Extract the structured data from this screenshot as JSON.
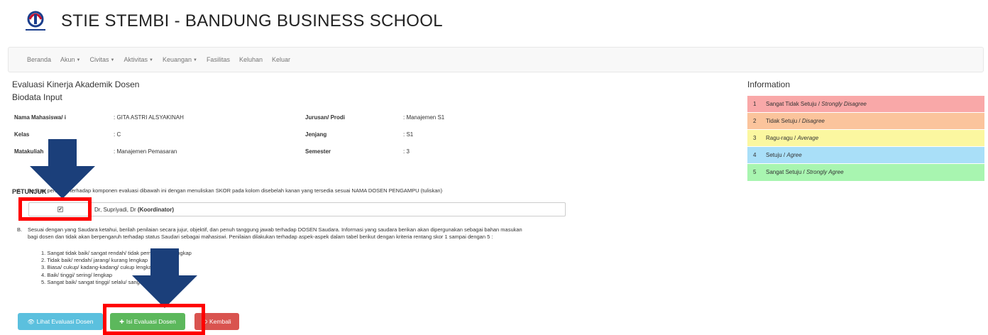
{
  "header": {
    "title": "STIE STEMBI - BANDUNG BUSINESS SCHOOL"
  },
  "nav": {
    "items": [
      {
        "label": "Beranda",
        "dropdown": false
      },
      {
        "label": "Akun",
        "dropdown": true
      },
      {
        "label": "Civitas",
        "dropdown": true
      },
      {
        "label": "Aktivitas",
        "dropdown": true
      },
      {
        "label": "Keuangan",
        "dropdown": true
      },
      {
        "label": "Fasilitas",
        "dropdown": false
      },
      {
        "label": "Keluhan",
        "dropdown": false
      },
      {
        "label": "Keluar",
        "dropdown": false
      }
    ]
  },
  "page": {
    "title": "Evaluasi Kinerja Akademik Dosen",
    "section": "Biodata Input"
  },
  "biodata": {
    "nama_label": "Nama Mahasiswa/ i",
    "nama_value": ": GITA ASTRI ALSYAKINAH",
    "kelas_label": "Kelas",
    "kelas_value": ": C",
    "matkul_label": "Matakuliah",
    "matkul_value": ": Manajemen Pemasaran",
    "jurusan_label": "Jurusan/ Prodi",
    "jurusan_value": ": Manajemen S1",
    "jenjang_label": "Jenjang",
    "jenjang_value": ": S1",
    "semester_label": "Semester",
    "semester_value": ": 3"
  },
  "petunjuk": {
    "title": "PETUNJUK",
    "a_letter": "A.",
    "a_text": "Berikan penilaian terhadap komponen evaluasi dibawah ini dengan menuliskan SKOR pada kolom disebelah kanan yang tersedia sesuai NAMA DOSEN PENGAMPU (tuliskan)",
    "b_letter": "B.",
    "b_line1": "Sesuai dengan yang Saudara ketahui, berilah penilaian secara jujur, objektif, dan penuh tanggung jawab terhadap DOSEN Saudara. Informasi yang saudara berikan akan dipergunakan sebagai bahan masukan",
    "b_line2": "bagi dosen dan tidak akan berpengaruh terhadap status Saudari sebagai mahasiswi. Penilaian dilakukan terhadap aspek-aspek dalam tabel berikut dengan kriteria rentang skor 1 sampai dengan 5 :"
  },
  "dosen": {
    "name": "Dr, Supriyadi, Dr",
    "role": "(Koordinator)",
    "checked": true
  },
  "skor": [
    "1. Sangat tidak baik/ sangat rendah/ tidak pernah/ tidak lengkap",
    "2. Tidak baik/ rendah/ jarang/ kurang lengkap",
    "3. Biasa/ cukup/ kadang-kadang/ cukup lengkap",
    "4. Baik/ tinggi/ sering/ lengkap",
    "5. Sangat baik/ sangat tinggi/ selalu/ sangat lengkap"
  ],
  "buttons": {
    "lihat": "Lihat Evaluasi Dosen",
    "isi": "Isi Evaluasi Dosen",
    "kembali": "Kembali"
  },
  "information": {
    "title": "Information",
    "rows": [
      {
        "num": "1",
        "text": "Sangat Tidak Setuju",
        "en": "Strongly Disagree",
        "color": "#f9a8a8"
      },
      {
        "num": "2",
        "text": "Tidak Setuju",
        "en": "Disagree",
        "color": "#fbc49c"
      },
      {
        "num": "3",
        "text": "Ragu-ragu",
        "en": "Average",
        "color": "#fbf7a0"
      },
      {
        "num": "4",
        "text": "Setuju",
        "en": "Agree",
        "color": "#a9dff8"
      },
      {
        "num": "5",
        "text": "Sangat Setuju",
        "en": "Strongly Agree",
        "color": "#a8f5b0"
      }
    ]
  },
  "colors": {
    "annotation": "#ff0000",
    "arrow": "#1b3f7a"
  }
}
